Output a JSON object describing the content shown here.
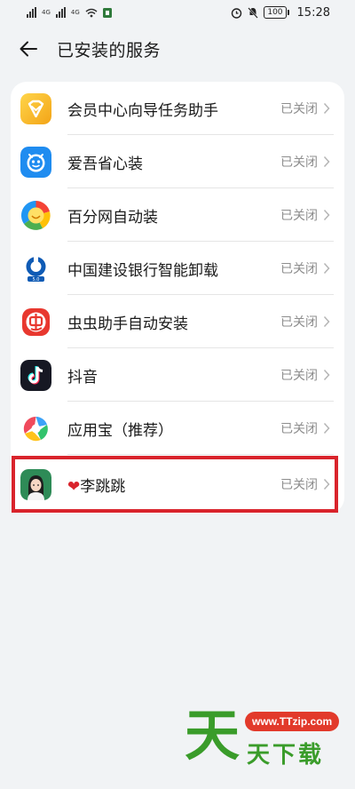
{
  "status_bar": {
    "time": "15:28",
    "battery": "100",
    "net_label_1": "4G",
    "net_label_2": "4G"
  },
  "header": {
    "title": "已安装的服务"
  },
  "services": [
    {
      "name": "会员中心向导任务助手",
      "status": "已关闭",
      "icon": "vip-diamond-icon"
    },
    {
      "name": "爱吾省心装",
      "status": "已关闭",
      "icon": "aiwu-icon"
    },
    {
      "name": "百分网自动装",
      "status": "已关闭",
      "icon": "baifen-icon"
    },
    {
      "name": "中国建设银行智能卸载",
      "status": "已关闭",
      "icon": "ccb-icon"
    },
    {
      "name": "虫虫助手自动安装",
      "status": "已关闭",
      "icon": "chongchong-icon"
    },
    {
      "name": "抖音",
      "status": "已关闭",
      "icon": "douyin-icon"
    },
    {
      "name": "应用宝（推荐）",
      "status": "已关闭",
      "icon": "yingyongbao-icon"
    },
    {
      "name": "李跳跳",
      "status": "已关闭",
      "icon": "litiaotiao-icon",
      "prefix_emoji": "❤"
    }
  ],
  "watermark": {
    "big": "天",
    "url": "www.TTzip.com",
    "small": "天下载"
  },
  "colors": {
    "background": "#f1f3f5",
    "card": "#ffffff",
    "highlight": "#d9242c",
    "status_text": "#8d8d8d"
  }
}
